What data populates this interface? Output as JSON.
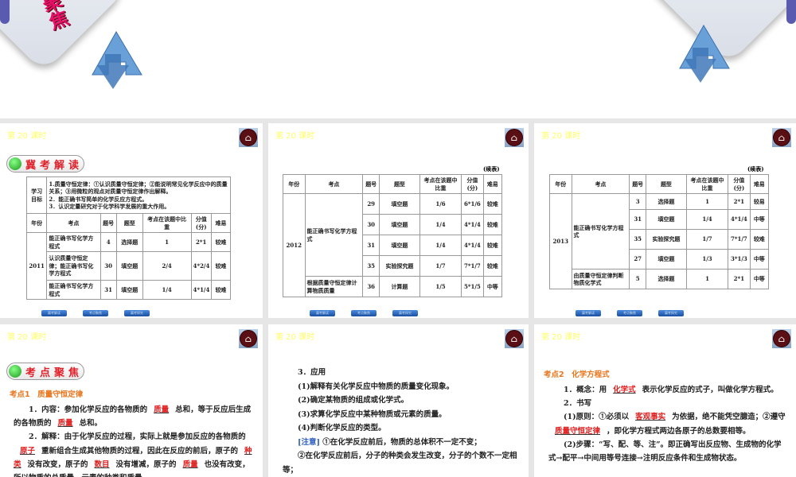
{
  "banner": {
    "text": "聚焦"
  },
  "lesson_label": "第 20 课时",
  "nav_buttons": [
    "冀考解读",
    "考点聚焦",
    "冀考探究"
  ],
  "slide1": {
    "badge": "冀考解读",
    "goal_header": "学习目标",
    "goals": [
      "1.质量守恒定律：①认识质量守恒定律；②能说明常见化学反应中的质量关系；③用微粒的观点对质量守恒定律作出解释。",
      "2．能正确书写简单的化学反应方程式。",
      "3．认识定量研究对于化学科学发展的重大作用。"
    ],
    "headers": [
      "年份",
      "考点",
      "题号",
      "题型",
      "考点在该题中比重",
      "分值(分)",
      "难易"
    ],
    "year": "2011",
    "rows": [
      {
        "point": "能正确书写化学方程式",
        "no": "4",
        "type": "选择题",
        "ratio": "1",
        "score": "2*1",
        "diff": "较难"
      },
      {
        "point": "认识质量守恒定律；能正确书写化学方程式",
        "no": "30",
        "type": "填空题",
        "ratio": "2/4",
        "score": "4*2/4",
        "diff": "较难"
      },
      {
        "point": "能正确书写化学方程式",
        "no": "31",
        "type": "填空题",
        "ratio": "1/4",
        "score": "4*1/4",
        "diff": "较难"
      }
    ]
  },
  "slide2": {
    "cont": "(续表)",
    "headers": [
      "年份",
      "考点",
      "题号",
      "题型",
      "考点在该题中比重",
      "分值(分)",
      "难易"
    ],
    "year": "2012",
    "groups": [
      {
        "point": "能正确书写化学方程式",
        "rows": [
          {
            "no": "29",
            "type": "填空题",
            "ratio": "1/6",
            "score": "6*1/6",
            "diff": "较难"
          },
          {
            "no": "30",
            "type": "填空题",
            "ratio": "1/4",
            "score": "4*1/4",
            "diff": "较难"
          },
          {
            "no": "31",
            "type": "填空题",
            "ratio": "1/4",
            "score": "4*1/4",
            "diff": "较难"
          },
          {
            "no": "35",
            "type": "实验探究题",
            "ratio": "1/7",
            "score": "7*1/7",
            "diff": "较难"
          }
        ]
      },
      {
        "point": "根据质量守恒定律计算物质质量",
        "rows": [
          {
            "no": "36",
            "type": "计算题",
            "ratio": "1/5",
            "score": "5*1/5",
            "diff": "中等"
          }
        ]
      }
    ]
  },
  "slide3": {
    "cont": "(续表)",
    "headers": [
      "年份",
      "考点",
      "题号",
      "题型",
      "考点在该题中比重",
      "分值(分)",
      "难易"
    ],
    "year": "2013",
    "groups": [
      {
        "point": "能正确书写化学方程式",
        "rows": [
          {
            "no": "3",
            "type": "选择题",
            "ratio": "1",
            "score": "2*1",
            "diff": "较易"
          },
          {
            "no": "31",
            "type": "填空题",
            "ratio": "1/4",
            "score": "4*1/4",
            "diff": "中等"
          },
          {
            "no": "35",
            "type": "实验探究题",
            "ratio": "1/7",
            "score": "7*1/7",
            "diff": "较难"
          },
          {
            "no": "27",
            "type": "填空题",
            "ratio": "1/3",
            "score": "3*1/3",
            "diff": "中等"
          }
        ]
      },
      {
        "point": "由质量守恒定律判断物质化学式",
        "rows": [
          {
            "no": "5",
            "type": "选择题",
            "ratio": "1",
            "score": "2*1",
            "diff": "中等"
          }
        ]
      }
    ]
  },
  "slide4": {
    "badge": "考点聚焦",
    "heading": "考点1　质量守恒定律",
    "paragraphs": [
      [
        {
          "t": "1．内容：参加化学反应的各物质的"
        },
        {
          "b": "质量"
        },
        {
          "t": "总和，等于反应后生成的各物质的"
        },
        {
          "b": "质量"
        },
        {
          "t": "总和。"
        }
      ],
      [
        {
          "t": "2．解释：由于化学反应的过程，实际上就是参加反应的各物质的"
        },
        {
          "b": "原子"
        },
        {
          "t": "重新组合生成其他物质的过程，因此在反应的前后，原子的"
        },
        {
          "b": "种类"
        },
        {
          "t": "没有改变，原子的"
        },
        {
          "b": "数目"
        },
        {
          "t": "没有增减，原子的"
        },
        {
          "b": "质量"
        },
        {
          "t": "也没有改变，所以物质的总质量、元素的种类和质量"
        }
      ]
    ]
  },
  "slide5": {
    "paragraphs": [
      [
        {
          "t": "3．应用"
        }
      ],
      [
        {
          "t": "(1)解释有关化学反应中物质的质量变化现象。"
        }
      ],
      [
        {
          "t": "(2)确定某物质的组成或化学式。"
        }
      ],
      [
        {
          "t": "(3)求算化学反应中某种物质或元素的质量。"
        }
      ],
      [
        {
          "t": "(4)判断化学反应的类型。"
        }
      ],
      [
        {
          "n": "[注意]"
        },
        {
          "t": " ①在化学反应前后，物质的总体积不一定不变；"
        }
      ],
      [
        {
          "t": "②在化学反应前后，分子的种类会发生改变，分子的个数不一定相等；"
        }
      ],
      [
        {
          "t": "③质量守恒定律的应用对象是化学变化，对于物理变化，不"
        }
      ]
    ]
  },
  "slide6": {
    "heading": "考点2　化学方程式",
    "paragraphs": [
      [
        {
          "t": "1．概念：用"
        },
        {
          "b": "化学式"
        },
        {
          "t": "表示化学反应的式子，叫做化学方程式。"
        }
      ],
      [
        {
          "t": "2．书写"
        }
      ],
      [
        {
          "t": "(1)原则：①必须以"
        },
        {
          "b": "客观事实"
        },
        {
          "t": "为依据，绝不能凭空臆造；②遵守"
        },
        {
          "b": "质量守恒定律"
        },
        {
          "t": "，即化学方程式两边各原子的总数要相等。"
        }
      ],
      [
        {
          "t": "(2)步骤：“写、配、等、注”。即正确写出反应物、生成物的化学式→配平→中间用等号连接→注明反应条件和生成物状态。"
        }
      ]
    ]
  }
}
